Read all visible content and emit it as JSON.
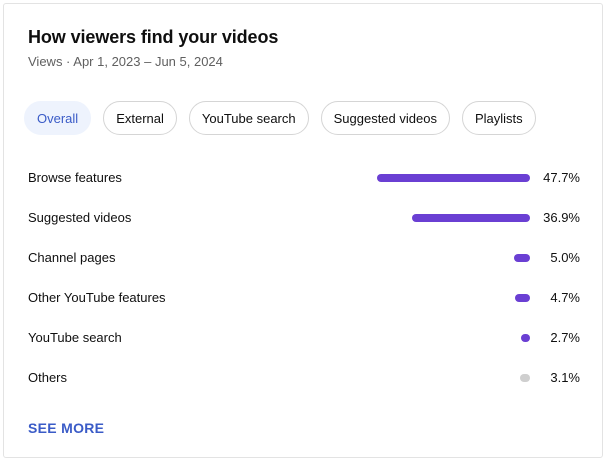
{
  "card": {
    "title": "How viewers find your videos",
    "subtitle": "Views · Apr 1, 2023 – Jun 5, 2024"
  },
  "tabs": [
    {
      "label": "Overall",
      "active": true
    },
    {
      "label": "External",
      "active": false
    },
    {
      "label": "YouTube search",
      "active": false
    },
    {
      "label": "Suggested videos",
      "active": false
    },
    {
      "label": "Playlists",
      "active": false
    }
  ],
  "sources": [
    {
      "label": "Browse features",
      "value": "47.7%",
      "percent": 47.7,
      "color": "#6a3fd3"
    },
    {
      "label": "Suggested videos",
      "value": "36.9%",
      "percent": 36.9,
      "color": "#6a3fd3"
    },
    {
      "label": "Channel pages",
      "value": "5.0%",
      "percent": 5.0,
      "color": "#6a3fd3"
    },
    {
      "label": "Other YouTube features",
      "value": "4.7%",
      "percent": 4.7,
      "color": "#6a3fd3"
    },
    {
      "label": "YouTube search",
      "value": "2.7%",
      "percent": 2.7,
      "color": "#6a3fd3"
    },
    {
      "label": "Others",
      "value": "3.1%",
      "percent": 3.1,
      "color": "#cfcfcf"
    }
  ],
  "footer": {
    "see_more_label": "SEE MORE"
  },
  "colors": {
    "accent": "#3a5bc7",
    "bar": "#6a3fd3",
    "bar_other": "#cfcfcf",
    "chip_active_bg": "#eef3fd"
  }
}
